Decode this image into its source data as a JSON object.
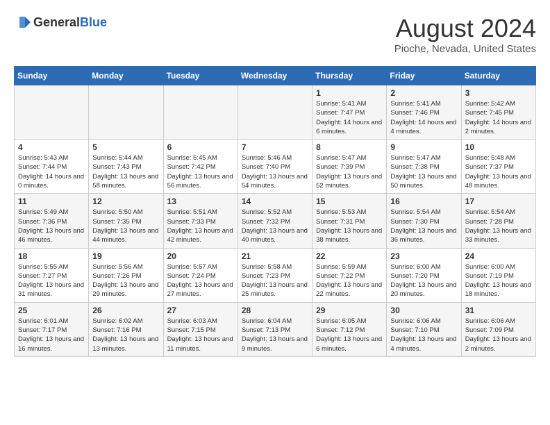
{
  "header": {
    "logo_general": "General",
    "logo_blue": "Blue",
    "title": "August 2024",
    "subtitle": "Pioche, Nevada, United States"
  },
  "calendar": {
    "days_of_week": [
      "Sunday",
      "Monday",
      "Tuesday",
      "Wednesday",
      "Thursday",
      "Friday",
      "Saturday"
    ],
    "weeks": [
      [
        {
          "day": "",
          "info": ""
        },
        {
          "day": "",
          "info": ""
        },
        {
          "day": "",
          "info": ""
        },
        {
          "day": "",
          "info": ""
        },
        {
          "day": "1",
          "info": "Sunrise: 5:41 AM\nSunset: 7:47 PM\nDaylight: 14 hours and 6 minutes."
        },
        {
          "day": "2",
          "info": "Sunrise: 5:41 AM\nSunset: 7:46 PM\nDaylight: 14 hours and 4 minutes."
        },
        {
          "day": "3",
          "info": "Sunrise: 5:42 AM\nSunset: 7:45 PM\nDaylight: 14 hours and 2 minutes."
        }
      ],
      [
        {
          "day": "4",
          "info": "Sunrise: 5:43 AM\nSunset: 7:44 PM\nDaylight: 14 hours and 0 minutes."
        },
        {
          "day": "5",
          "info": "Sunrise: 5:44 AM\nSunset: 7:43 PM\nDaylight: 13 hours and 58 minutes."
        },
        {
          "day": "6",
          "info": "Sunrise: 5:45 AM\nSunset: 7:42 PM\nDaylight: 13 hours and 56 minutes."
        },
        {
          "day": "7",
          "info": "Sunrise: 5:46 AM\nSunset: 7:40 PM\nDaylight: 13 hours and 54 minutes."
        },
        {
          "day": "8",
          "info": "Sunrise: 5:47 AM\nSunset: 7:39 PM\nDaylight: 13 hours and 52 minutes."
        },
        {
          "day": "9",
          "info": "Sunrise: 5:47 AM\nSunset: 7:38 PM\nDaylight: 13 hours and 50 minutes."
        },
        {
          "day": "10",
          "info": "Sunrise: 5:48 AM\nSunset: 7:37 PM\nDaylight: 13 hours and 48 minutes."
        }
      ],
      [
        {
          "day": "11",
          "info": "Sunrise: 5:49 AM\nSunset: 7:36 PM\nDaylight: 13 hours and 46 minutes."
        },
        {
          "day": "12",
          "info": "Sunrise: 5:50 AM\nSunset: 7:35 PM\nDaylight: 13 hours and 44 minutes."
        },
        {
          "day": "13",
          "info": "Sunrise: 5:51 AM\nSunset: 7:33 PM\nDaylight: 13 hours and 42 minutes."
        },
        {
          "day": "14",
          "info": "Sunrise: 5:52 AM\nSunset: 7:32 PM\nDaylight: 13 hours and 40 minutes."
        },
        {
          "day": "15",
          "info": "Sunrise: 5:53 AM\nSunset: 7:31 PM\nDaylight: 13 hours and 38 minutes."
        },
        {
          "day": "16",
          "info": "Sunrise: 5:54 AM\nSunset: 7:30 PM\nDaylight: 13 hours and 36 minutes."
        },
        {
          "day": "17",
          "info": "Sunrise: 5:54 AM\nSunset: 7:28 PM\nDaylight: 13 hours and 33 minutes."
        }
      ],
      [
        {
          "day": "18",
          "info": "Sunrise: 5:55 AM\nSunset: 7:27 PM\nDaylight: 13 hours and 31 minutes."
        },
        {
          "day": "19",
          "info": "Sunrise: 5:56 AM\nSunset: 7:26 PM\nDaylight: 13 hours and 29 minutes."
        },
        {
          "day": "20",
          "info": "Sunrise: 5:57 AM\nSunset: 7:24 PM\nDaylight: 13 hours and 27 minutes."
        },
        {
          "day": "21",
          "info": "Sunrise: 5:58 AM\nSunset: 7:23 PM\nDaylight: 13 hours and 25 minutes."
        },
        {
          "day": "22",
          "info": "Sunrise: 5:59 AM\nSunset: 7:22 PM\nDaylight: 13 hours and 22 minutes."
        },
        {
          "day": "23",
          "info": "Sunrise: 6:00 AM\nSunset: 7:20 PM\nDaylight: 13 hours and 20 minutes."
        },
        {
          "day": "24",
          "info": "Sunrise: 6:00 AM\nSunset: 7:19 PM\nDaylight: 13 hours and 18 minutes."
        }
      ],
      [
        {
          "day": "25",
          "info": "Sunrise: 6:01 AM\nSunset: 7:17 PM\nDaylight: 13 hours and 16 minutes."
        },
        {
          "day": "26",
          "info": "Sunrise: 6:02 AM\nSunset: 7:16 PM\nDaylight: 13 hours and 13 minutes."
        },
        {
          "day": "27",
          "info": "Sunrise: 6:03 AM\nSunset: 7:15 PM\nDaylight: 13 hours and 11 minutes."
        },
        {
          "day": "28",
          "info": "Sunrise: 6:04 AM\nSunset: 7:13 PM\nDaylight: 13 hours and 9 minutes."
        },
        {
          "day": "29",
          "info": "Sunrise: 6:05 AM\nSunset: 7:12 PM\nDaylight: 13 hours and 6 minutes."
        },
        {
          "day": "30",
          "info": "Sunrise: 6:06 AM\nSunset: 7:10 PM\nDaylight: 13 hours and 4 minutes."
        },
        {
          "day": "31",
          "info": "Sunrise: 6:06 AM\nSunset: 7:09 PM\nDaylight: 13 hours and 2 minutes."
        }
      ]
    ]
  }
}
